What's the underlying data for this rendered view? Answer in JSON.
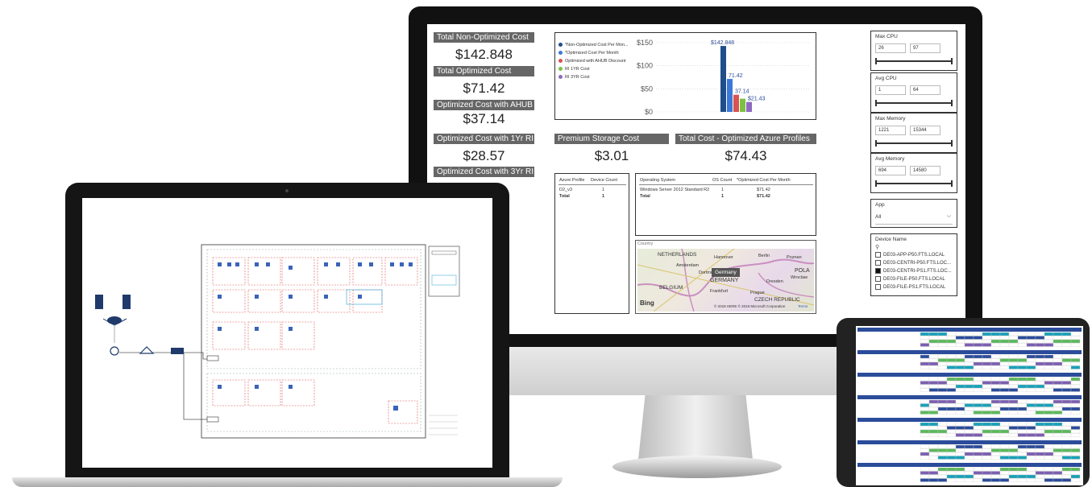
{
  "dashboard": {
    "kpis": [
      {
        "label": "Total Non-Optimized Cost",
        "value": "$142.848"
      },
      {
        "label": "Total Optimized Cost",
        "value": "$71.42"
      },
      {
        "label": "Optimized Cost with AHUB",
        "value": "$37.14"
      },
      {
        "label": "Optimized Cost with 1Yr RI",
        "value": "$28.57"
      },
      {
        "label": "Optimized Cost with 3Yr RI",
        "value": ""
      }
    ],
    "premium": {
      "label": "Premium Storage Cost",
      "value": "$3.01"
    },
    "total_opt": {
      "label": "Total Cost - Optimized Azure Profiles",
      "value": "$74.43"
    },
    "profile_table": {
      "headers": [
        "Azure Profile",
        "Device Count"
      ],
      "rows": [
        [
          "D2_v3",
          "1"
        ],
        [
          "Total",
          "1"
        ]
      ]
    },
    "os_table": {
      "headers": [
        "Operating System",
        "OS Count",
        "*Optimized Cost Per Month"
      ],
      "rows": [
        [
          "Windows Server 2012 Standard R2",
          "1",
          "$71.42"
        ],
        [
          "Total",
          "1",
          "$71.42"
        ]
      ]
    },
    "map": {
      "title": "Country",
      "labels": [
        "NETHERLANDS",
        "Hannover",
        "Berlin",
        "Poznan",
        "Amsterdam",
        "Dortmund",
        "Germany",
        "POLA",
        "Wroclaw",
        "BELGIUM",
        "GERMANY",
        "Dresden",
        "Frankfurt",
        "Prague",
        "CZECH REPUBLIC"
      ],
      "tooltip": "Germany",
      "bing": "Bing",
      "copyright": "© 2018 HERE © 2018 Microsoft Corporation",
      "terms": "Terms"
    },
    "slicers": [
      {
        "title": "Max CPU",
        "min": "26",
        "max": "97"
      },
      {
        "title": "Avg CPU",
        "min": "1",
        "max": "64"
      },
      {
        "title": "Max Memory",
        "min": "1221",
        "max": "15344"
      },
      {
        "title": "Avg Memory",
        "min": "694",
        "max": "14580"
      }
    ],
    "app": {
      "title": "App",
      "value": "All"
    },
    "device": {
      "title": "Device Name",
      "items": [
        "DE03-APP-P50.FTS.LOCAL",
        "DE03-CENTRI-P50.FTS.LOC...",
        "DE03-CENTRI-PS1.FTS.LOC...",
        "DE03-FILE-P50.FTS.LOCAL",
        "DE03-FILE-PS1.FTS.LOCAL"
      ],
      "checked": [
        false,
        false,
        true,
        false,
        false
      ]
    }
  },
  "chart_data": {
    "type": "bar",
    "categories": [
      "*Non-Optimized Cost Per Mon...",
      "*Optimized Cost Per Month",
      "Optimized with AHUB Discount",
      "RI 1YR Cost",
      "RI 3YR Cost"
    ],
    "values": [
      142.848,
      71.42,
      37.14,
      28.57,
      21.43
    ],
    "data_labels": [
      "$142.848",
      "71.42",
      "37.14",
      "",
      "$21.43"
    ],
    "colors": [
      "#1f4e8c",
      "#3b78d8",
      "#d9534f",
      "#7cc142",
      "#8e6bbf"
    ],
    "yticks": [
      "$150",
      "$100",
      "$50",
      "$0"
    ],
    "ylim": [
      0,
      150
    ]
  },
  "colors": {
    "kpi_header": "#666666",
    "grid_blue": "#2b4c9a",
    "grid_teal": "#1aa0b8",
    "grid_green": "#5cb85c",
    "grid_purple": "#7b5fb0"
  }
}
